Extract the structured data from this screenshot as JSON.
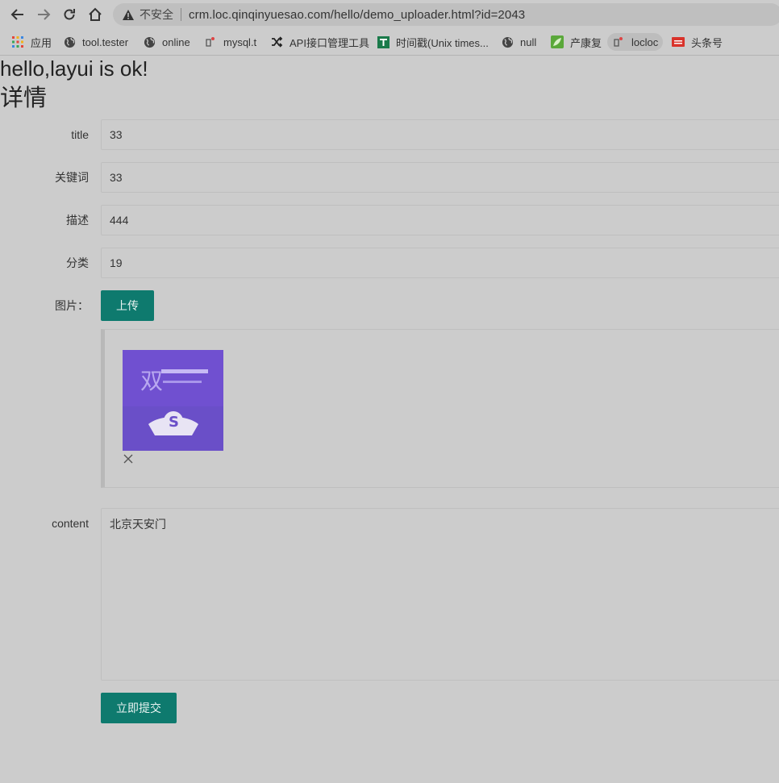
{
  "browser": {
    "security_label": "不安全",
    "url": "crm.loc.qinqinyuesao.com/hello/demo_uploader.html?id=2043",
    "bookmarks": [
      {
        "label": "应用",
        "icon": "apps-grid-icon"
      },
      {
        "label": "tool.tester",
        "icon": "globe-icon"
      },
      {
        "label": "online",
        "icon": "globe-icon"
      },
      {
        "label": "mysql.t",
        "icon": "broken-page-icon"
      },
      {
        "label": "API接口管理工具",
        "icon": "shuffle-icon"
      },
      {
        "label": "时间戳(Unix times...",
        "icon": "t-square-icon"
      },
      {
        "label": "null",
        "icon": "globe-icon"
      },
      {
        "label": "产康复",
        "icon": "leaf-icon"
      },
      {
        "label": "locloc",
        "icon": "broken-page-icon"
      },
      {
        "label": "头条号",
        "icon": "toutiao-icon"
      }
    ]
  },
  "page": {
    "heading": "hello,layui is ok!",
    "subheading": "详情"
  },
  "form": {
    "title_label": "title",
    "title_value": "33",
    "keywords_label": "关键词",
    "keywords_value": "33",
    "description_label": "描述",
    "description_value": "444",
    "category_label": "分类",
    "category_value": "19",
    "image_label": "图片：",
    "upload_button": "上传",
    "content_label": "content",
    "content_value": "北京天安门",
    "submit_button": "立即提交"
  },
  "colors": {
    "background": "#cccccc",
    "primary_button": "#0e7a6e",
    "thumbnail": "#6a4fc8"
  }
}
